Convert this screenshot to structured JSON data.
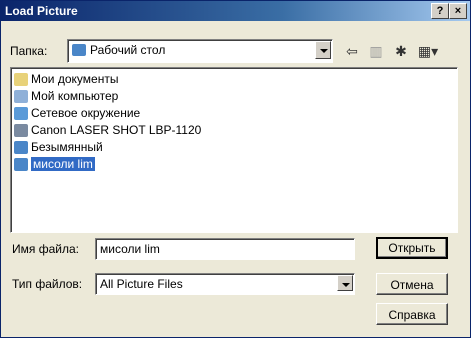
{
  "window": {
    "title": "Load Picture",
    "help_btn": "?",
    "close_btn": "×"
  },
  "location": {
    "label": "Папка:",
    "value": "Рабочий стол"
  },
  "files": [
    {
      "label": "Мои документы",
      "icon": "documents-icon",
      "color": "#e8d27a",
      "selected": false
    },
    {
      "label": "Мой компьютер",
      "icon": "computer-icon",
      "color": "#8fb0d8",
      "selected": false
    },
    {
      "label": "Сетевое окружение",
      "icon": "network-icon",
      "color": "#5a9ad8",
      "selected": false
    },
    {
      "label": "Canon LASER SHOT LBP-1120",
      "icon": "printer-icon",
      "color": "#7a8aa0",
      "selected": false
    },
    {
      "label": "Безымянный",
      "icon": "picture-icon",
      "color": "#4a86c8",
      "selected": false
    },
    {
      "label": "мисоли lim",
      "icon": "picture-icon",
      "color": "#4a86c8",
      "selected": true
    }
  ],
  "filename": {
    "label": "Имя файла:",
    "value": "мисоли lim"
  },
  "filetype": {
    "label": "Тип файлов:",
    "value": "All Picture Files"
  },
  "buttons": {
    "open": "Открыть",
    "cancel": "Отмена",
    "help": "Справка"
  },
  "toolbar": {
    "back": "⇦",
    "up": "▥",
    "newfolder": "✱",
    "view": "▦▾"
  }
}
